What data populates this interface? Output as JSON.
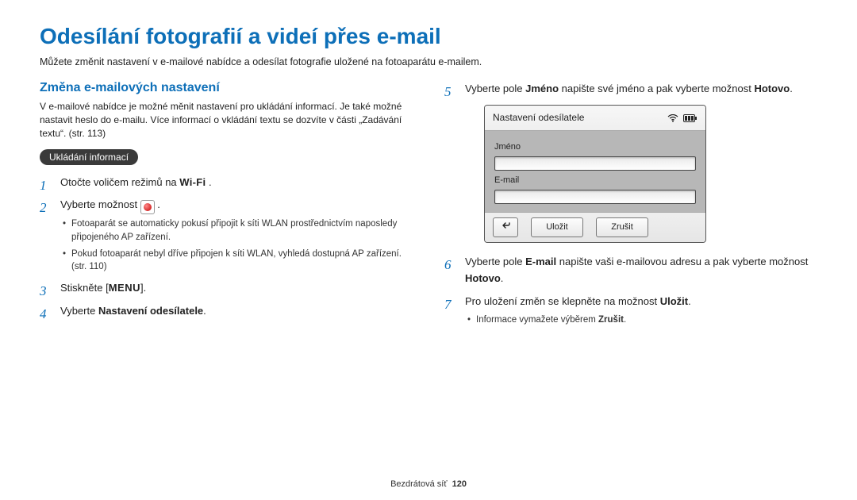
{
  "title": "Odesílání fotografií a videí přes e-mail",
  "intro": "Můžete změnit nastavení v e-mailové nabídce a odesílat fotografie uložené na fotoaparátu e-mailem.",
  "left": {
    "subhead": "Změna e-mailových nastavení",
    "desc": "V e-mailové nabídce je možné měnit nastavení pro ukládání informací. Je také možné nastavit heslo do e-mailu. Více informací o vkládání textu se dozvíte v části „Zadávání textu“. (str. 113)",
    "pill": "Ukládání informací",
    "step1_a": "Otočte voličem režimů na ",
    "step1_wifi": "Wi-Fi",
    "step1_b": " .",
    "step2_a": "Vyberte možnost ",
    "step2_b": " .",
    "step2_b1": "Fotoaparát se automaticky pokusí připojit k síti WLAN prostřednictvím naposledy připojeného AP zařízení.",
    "step2_b2": "Pokud fotoaparát nebyl dříve připojen k síti WLAN, vyhledá dostupná AP zařízení. (str. 110)",
    "step3_a": "Stiskněte [",
    "step3_menu": "MENU",
    "step3_b": "].",
    "step4_a": "Vyberte ",
    "step4_bold": "Nastavení odesílatele",
    "step4_b": "."
  },
  "right": {
    "step5_a": "Vyberte pole ",
    "step5_b1": "Jméno",
    "step5_c": " napište své jméno a pak vyberte možnost ",
    "step5_b2": "Hotovo",
    "step5_d": ".",
    "device": {
      "title": "Nastavení odesílatele",
      "field1": "Jméno",
      "field2": "E-mail",
      "save": "Uložit",
      "cancel": "Zrušit"
    },
    "step6_a": "Vyberte pole ",
    "step6_b1": "E-mail",
    "step6_c": " napište vaši e-mailovou adresu a pak vyberte možnost ",
    "step6_b2": "Hotovo",
    "step6_d": ".",
    "step7_a": "Pro uložení změn se klepněte na možnost ",
    "step7_b1": "Uložit",
    "step7_b": ".",
    "step7_bullet": "Informace vymažete výběrem ",
    "step7_bullet_bold": "Zrušit",
    "step7_bullet_end": "."
  },
  "footer": {
    "section": "Bezdrátová síť",
    "page": "120"
  }
}
